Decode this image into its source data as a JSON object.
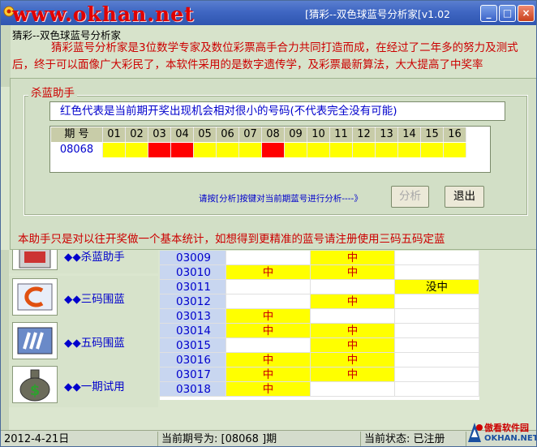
{
  "window": {
    "watermark": "www.okhan.net",
    "title": "[猜彩--双色球蓝号分析家[v1.02",
    "min_label": "_",
    "max_label": "□",
    "close_label": "×"
  },
  "intro": {
    "heading": "猜彩--双色球蓝号分析家",
    "text": "猜彩蓝号分析家是3位数学专家及数位彩票高手合力共同打造而成，在经过了二年多的努力及测式后，终于可以面像广大彩民了，本软件采用的是数字遗传学，及彩票最新算法，大大提高了中奖率"
  },
  "dialog": {
    "caption": "杀蓝助手",
    "notice": "红色代表是当前期开奖出现机会相对很小的号码(不代表完全没有可能)",
    "grid": {
      "header_label": "期 号",
      "numbers": [
        "01",
        "02",
        "03",
        "04",
        "05",
        "06",
        "07",
        "08",
        "09",
        "10",
        "11",
        "12",
        "13",
        "14",
        "15",
        "16"
      ],
      "issue": "08068",
      "red_numbers": [
        "03",
        "04",
        "08"
      ]
    },
    "hint": "请按[分析]按键对当前期蓝号进行分析----》",
    "analyze_label": "分析",
    "exit_label": "退出",
    "bottom_note": "本助手只是对以往开奖做一个基本统计，如想得到更精准的蓝号请注册使用三码五码定蓝"
  },
  "sidebar": {
    "items": [
      {
        "label": "◆◆杀蓝助手",
        "icon": "kill-blue-icon"
      },
      {
        "label": "◆◆三码围蓝",
        "icon": "three-code-icon"
      },
      {
        "label": "◆◆五码围蓝",
        "icon": "five-code-icon"
      },
      {
        "label": "◆◆一期试用",
        "icon": "money-bag-icon"
      }
    ]
  },
  "history": {
    "hit_label": "中",
    "miss_label": "没中",
    "rows": [
      {
        "issue": "03009",
        "marks": [
          "",
          "",
          "中",
          "",
          ""
        ]
      },
      {
        "issue": "03010",
        "marks": [
          "",
          "中",
          "中",
          "",
          ""
        ]
      },
      {
        "issue": "03011",
        "marks": [
          "",
          "",
          "",
          "没中",
          ""
        ]
      },
      {
        "issue": "03012",
        "marks": [
          "",
          "",
          "中",
          "",
          ""
        ]
      },
      {
        "issue": "03013",
        "marks": [
          "",
          "中",
          "",
          "",
          ""
        ]
      },
      {
        "issue": "03014",
        "marks": [
          "",
          "中",
          "中",
          "",
          ""
        ]
      },
      {
        "issue": "03015",
        "marks": [
          "",
          "",
          "中",
          "",
          ""
        ]
      },
      {
        "issue": "03016",
        "marks": [
          "",
          "中",
          "中",
          "",
          ""
        ]
      },
      {
        "issue": "03017",
        "marks": [
          "",
          "中",
          "中",
          "",
          ""
        ]
      },
      {
        "issue": "03018",
        "marks": [
          "",
          "中",
          "",
          "",
          ""
        ]
      }
    ]
  },
  "statusbar": {
    "date": "2012-4-21日",
    "current_issue": "当前期号为: [08068 ]期",
    "state": "当前状态: 已注册"
  },
  "logo": {
    "text1": "傲看软件园",
    "text2": "OKHAN.NET"
  },
  "colors": {
    "red": "#ff0000",
    "yellow": "#ffff00",
    "blue_text": "#0000cc",
    "red_text": "#cc0000"
  }
}
